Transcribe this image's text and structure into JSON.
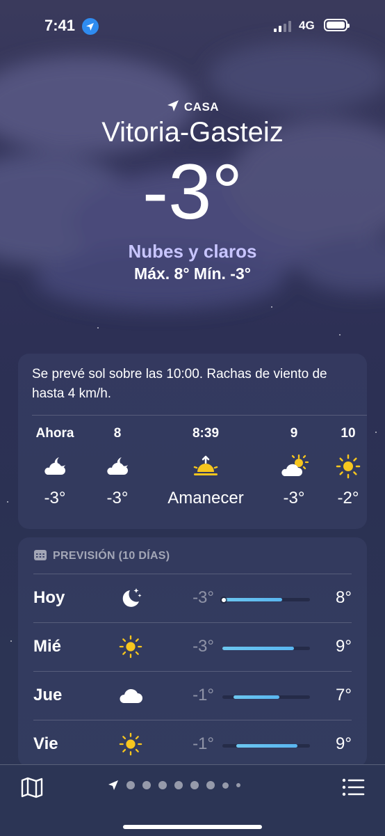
{
  "status_bar": {
    "time": "7:41",
    "network": "4G"
  },
  "header": {
    "location_label": "CASA",
    "city": "Vitoria-Gasteiz",
    "temperature": "-3°",
    "condition": "Nubes y claros",
    "high_low": "Máx. 8°  Mín. -3°"
  },
  "summary": {
    "text": "Se prevé sol sobre las 10:00. Rachas de viento de hasta 4 km/h.",
    "hours": [
      {
        "label": "Ahora",
        "icon": "cloud-moon-icon",
        "value": "-3°"
      },
      {
        "label": "8",
        "icon": "cloud-moon-icon",
        "value": "-3°"
      },
      {
        "label": "8:39",
        "icon": "sunrise-icon",
        "value": "Amanecer"
      },
      {
        "label": "9",
        "icon": "cloud-sun-icon",
        "value": "-3°"
      },
      {
        "label": "10",
        "icon": "sun-icon",
        "value": "-2°"
      }
    ]
  },
  "forecast": {
    "title": "PREVISIÓN (10 DÍAS)",
    "days": [
      {
        "day": "Hoy",
        "icon": "moon-stars-icon",
        "low": "-3°",
        "high": "8°",
        "range_start": 0.0,
        "range_end": 0.68,
        "current": 0.0
      },
      {
        "day": "Mié",
        "icon": "sun-icon",
        "low": "-3°",
        "high": "9°",
        "range_start": 0.0,
        "range_end": 0.82
      },
      {
        "day": "Jue",
        "icon": "cloud-icon",
        "low": "-1°",
        "high": "7°",
        "range_start": 0.13,
        "range_end": 0.65
      },
      {
        "day": "Vie",
        "icon": "sun-icon",
        "low": "-1°",
        "high": "9°",
        "range_start": 0.16,
        "range_end": 0.86
      }
    ]
  },
  "bottom_bar": {
    "pages": 9,
    "current_page": 0
  },
  "colors": {
    "accent_condition": "#c8c5ff",
    "bar_fill": "#5fbdf0",
    "sun": "#f7c61e",
    "location_blue": "#2f8cf0"
  }
}
